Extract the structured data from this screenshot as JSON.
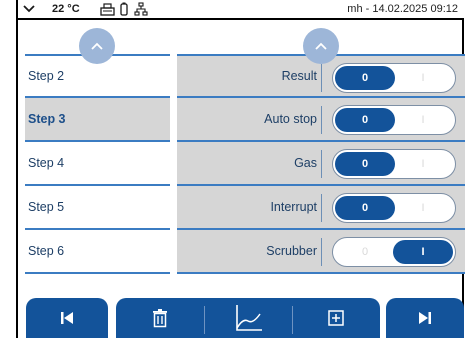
{
  "status_bar": {
    "temperature": "22 °C",
    "user_datetime": "mh - 14.02.2025 09:12",
    "icons": [
      "chevron-down-icon",
      "printer-icon",
      "battery-icon",
      "network-icon"
    ]
  },
  "steps": [
    {
      "label": "Step 2",
      "active": false
    },
    {
      "label": "Step 3",
      "active": true
    },
    {
      "label": "Step 4",
      "active": false
    },
    {
      "label": "Step 5",
      "active": false
    },
    {
      "label": "Step 6",
      "active": false
    }
  ],
  "params": [
    {
      "label": "Result",
      "off_label": "0",
      "on_label": "I",
      "state": "0"
    },
    {
      "label": "Auto stop",
      "off_label": "0",
      "on_label": "I",
      "state": "0"
    },
    {
      "label": "Gas",
      "off_label": "0",
      "on_label": "I",
      "state": "0"
    },
    {
      "label": "Interrupt",
      "off_label": "0",
      "on_label": "I",
      "state": "0"
    },
    {
      "label": "Scrubber",
      "off_label": "0",
      "on_label": "I",
      "state": "I"
    }
  ],
  "toolbar": {
    "icons": [
      "skip-back-icon",
      "trash-icon",
      "chart-icon",
      "add-icon",
      "skip-forward-icon"
    ]
  },
  "colors": {
    "accent": "#13539a",
    "selection": "#d6d6d6",
    "divider": "#3b7cc2",
    "scroll_button": "#9db6d8"
  }
}
